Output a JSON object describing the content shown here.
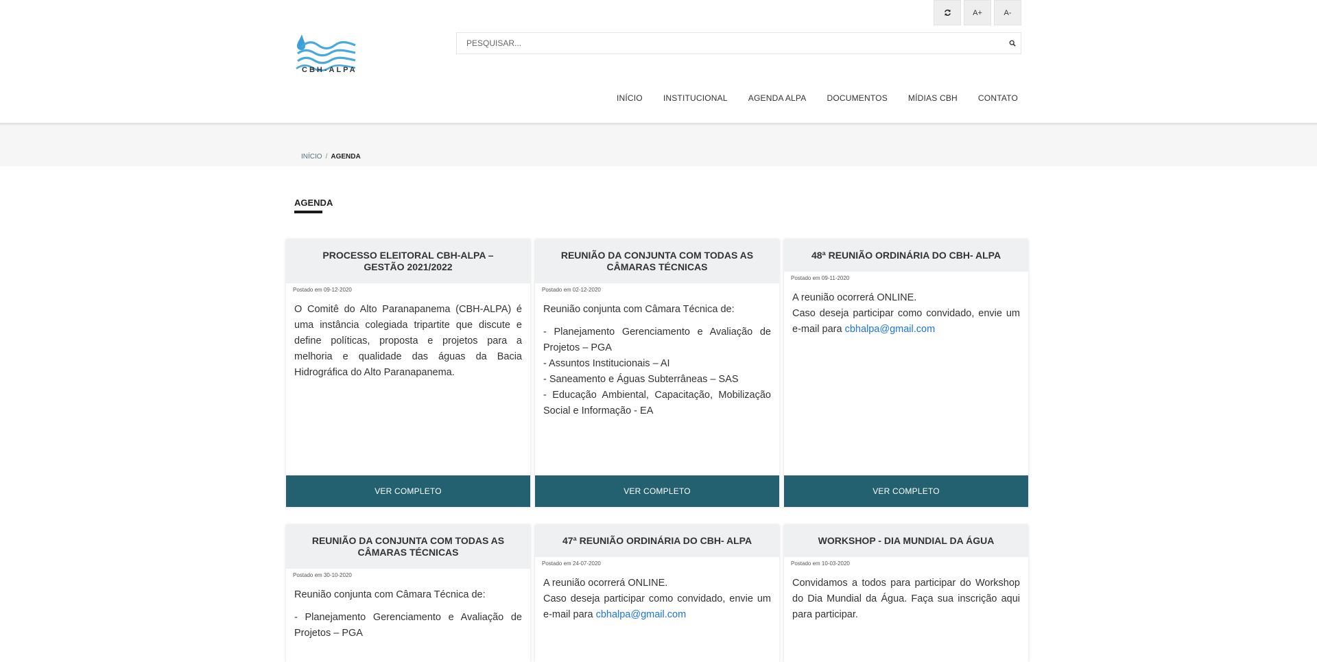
{
  "toolbar": {
    "refresh_icon": "refresh-icon",
    "font_increase": "A+",
    "font_decrease": "A-"
  },
  "logo": {
    "text": "CBH-ALPA",
    "icon": "water-waves-logo"
  },
  "search": {
    "placeholder": "PESQUISAR...",
    "value": "",
    "icon": "search-icon"
  },
  "nav": [
    "INÍCIO",
    "INSTITUCIONAL",
    "AGENDA ALPA",
    "DOCUMENTOS",
    "MÍDIAS CBH",
    "CONTATO"
  ],
  "breadcrumb": {
    "home": "INÍCIO",
    "separator": "/",
    "current": "AGENDA"
  },
  "page_title": "AGENDA",
  "colors": {
    "button_bg": "#236170",
    "link": "#1a73e8",
    "card_header_bg": "#eff0f1"
  },
  "cards": [
    {
      "title": "PROCESSO ELEITORAL CBH-ALPA – GESTÃO 2021/2022",
      "date": "Postado em 09-12-2020",
      "p1": "O Comitê do Alto Paranapanema (CBH-ALPA) é uma instância colegiada tripartite que discute e define políticas, proposta e projetos para a melhoria e qualidade das águas da Bacia Hidrográfica do Alto Paranapanema.",
      "button": "VER COMPLETO"
    },
    {
      "title": "REUNIÃO DA CONJUNTA COM TODAS AS CÂMARAS TÉCNICAS",
      "date": "Postado em 02-12-2020",
      "p1": "Reunião conjunta com Câmara Técnica de:",
      "l1": "- Planejamento Gerenciamento e Avaliação de Projetos – PGA",
      "l2": "- Assuntos Institucionais – AI",
      "l3": "- Saneamento e Águas Subterrâneas – SAS",
      "l4": "- Educação Ambiental, Capacitação, Mobilização Social e Informação - EA",
      "button": "VER COMPLETO"
    },
    {
      "title": "48ª REUNIÃO ORDINÁRIA DO CBH- ALPA",
      "date": "Postado em 09-11-2020",
      "l1": "A reunião ocorrerá ONLINE.",
      "l2": "Caso deseja participar como convidado, envie um e-mail para ",
      "email": "cbhalpa@gmail.com",
      "button": "VER COMPLETO"
    },
    {
      "title": "REUNIÃO DA CONJUNTA COM TODAS AS CÂMARAS TÉCNICAS",
      "date": "Postado em 30-10-2020",
      "p1": "Reunião conjunta com Câmara Técnica de:",
      "l1": "- Planejamento Gerenciamento e Avaliação de Projetos – PGA"
    },
    {
      "title": "47ª REUNIÃO ORDINÁRIA DO CBH- ALPA",
      "date": "Postado em 24-07-2020",
      "l1": "A reunião ocorrerá ONLINE.",
      "l2": "Caso deseja participar como convidado, envie um e-mail para ",
      "email": "cbhalpa@gmail.com"
    },
    {
      "title": "WORKSHOP - DIA MUNDIAL DA ÁGUA",
      "date": "Postado em 10-03-2020",
      "p1": "Convidamos a todos para participar do Workshop do Dia Mundial da Água. Faça sua inscrição aqui para participar."
    }
  ]
}
